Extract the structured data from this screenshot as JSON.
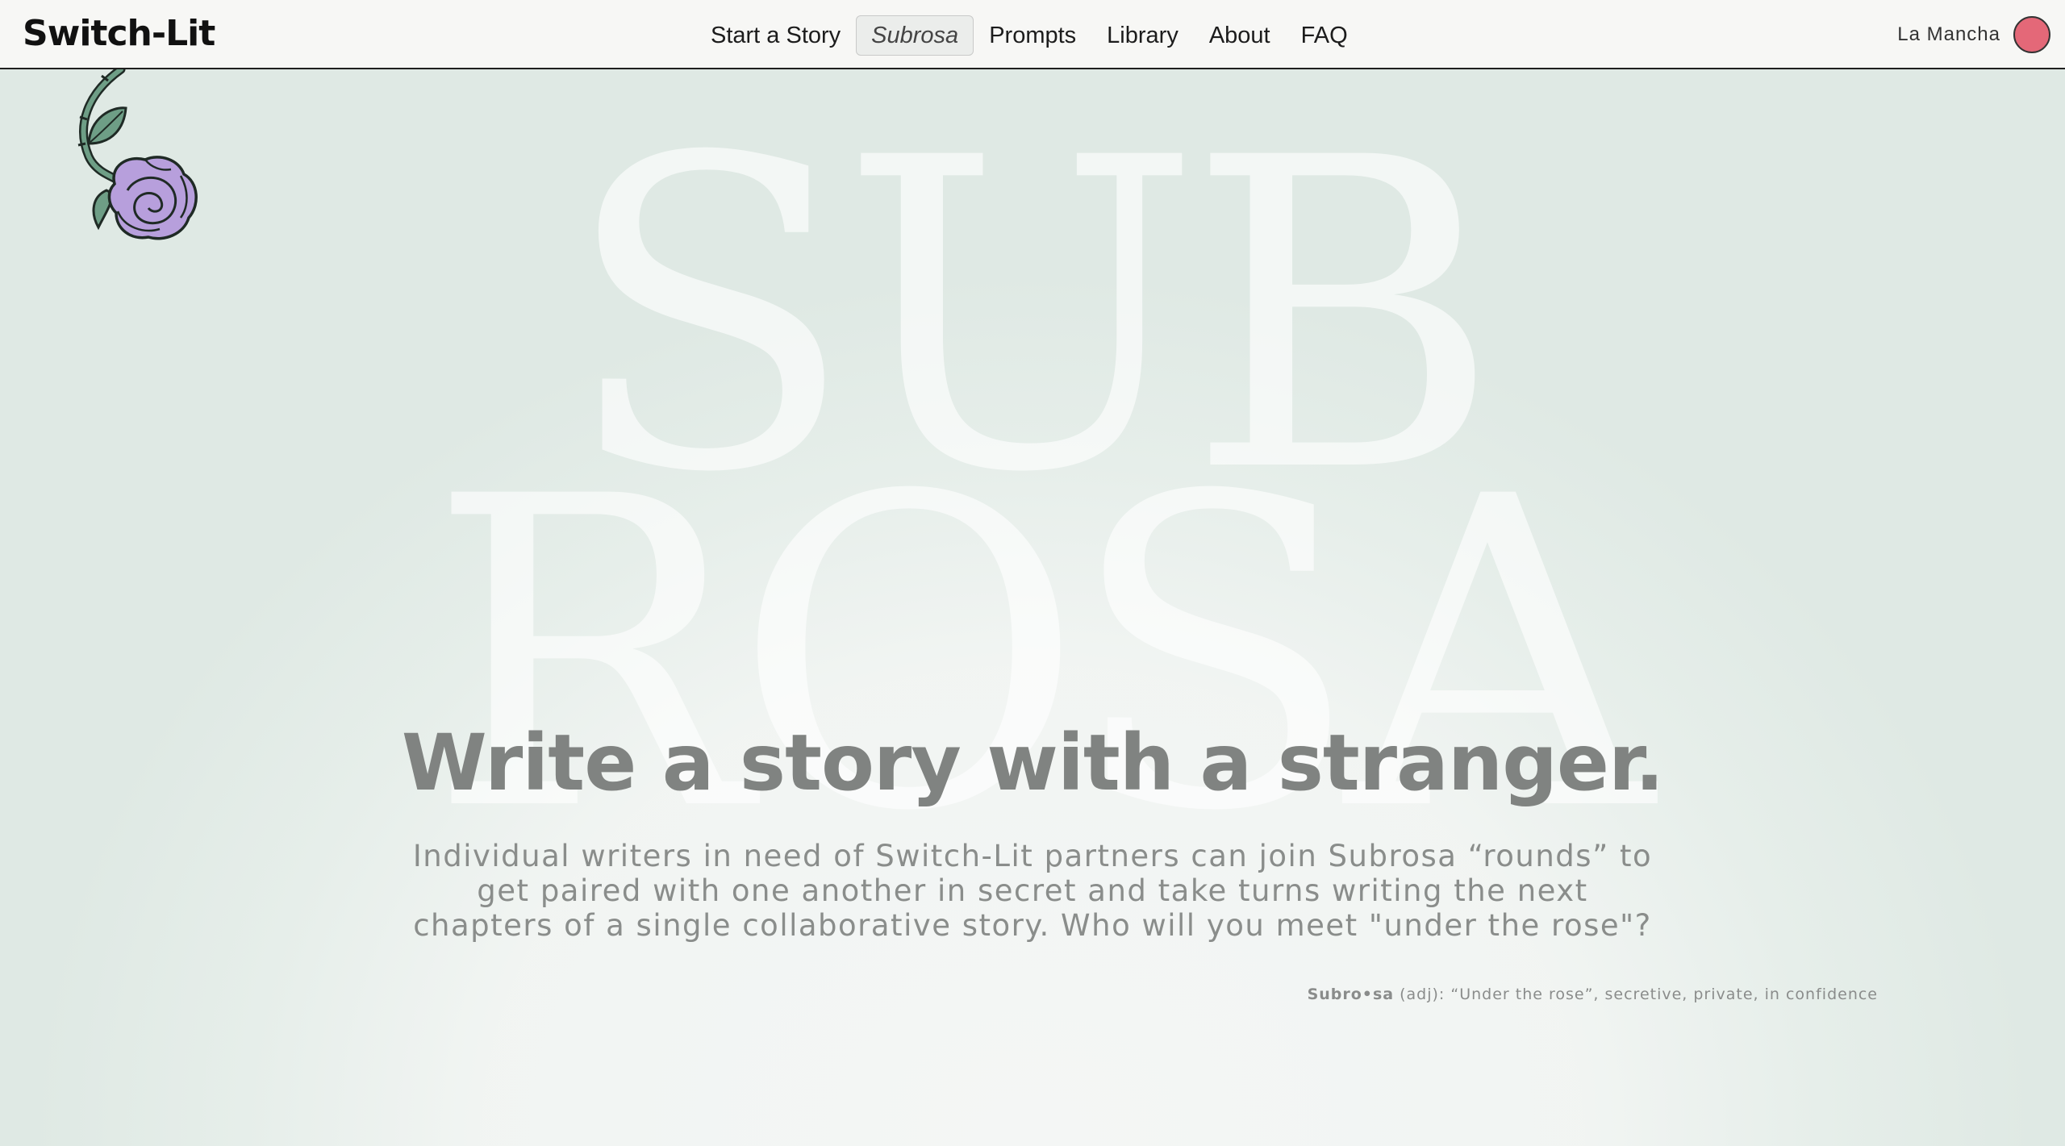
{
  "header": {
    "logo": "Switch-Lit",
    "nav": [
      {
        "label": "Start a Story"
      },
      {
        "label": "Subrosa",
        "active": true
      },
      {
        "label": "Prompts"
      },
      {
        "label": "Library"
      },
      {
        "label": "About"
      },
      {
        "label": "FAQ"
      }
    ],
    "user": {
      "name": "La Mancha",
      "avatar_color": "#e46878"
    }
  },
  "hero": {
    "background_words": [
      "SUB",
      "ROSA"
    ],
    "headline": "Write a story with a stranger.",
    "description": "Individual writers in need of Switch-Lit partners can join Subrosa “rounds” to get paired with one another in secret and take turns writing the next chapters of a single collaborative story. Who will you meet \"under the rose\"?",
    "definition_term": "Subro•sa",
    "definition_text": " (adj): “Under the rose”, secretive, private, in confidence"
  },
  "colors": {
    "background": "#dfe9e4",
    "header_bg": "#f7f7f5",
    "text_muted": "#808381",
    "rose_petal": "#b79fdc",
    "rose_leaf": "#6e9e86"
  },
  "icons": {
    "decoration": "rose-icon"
  }
}
